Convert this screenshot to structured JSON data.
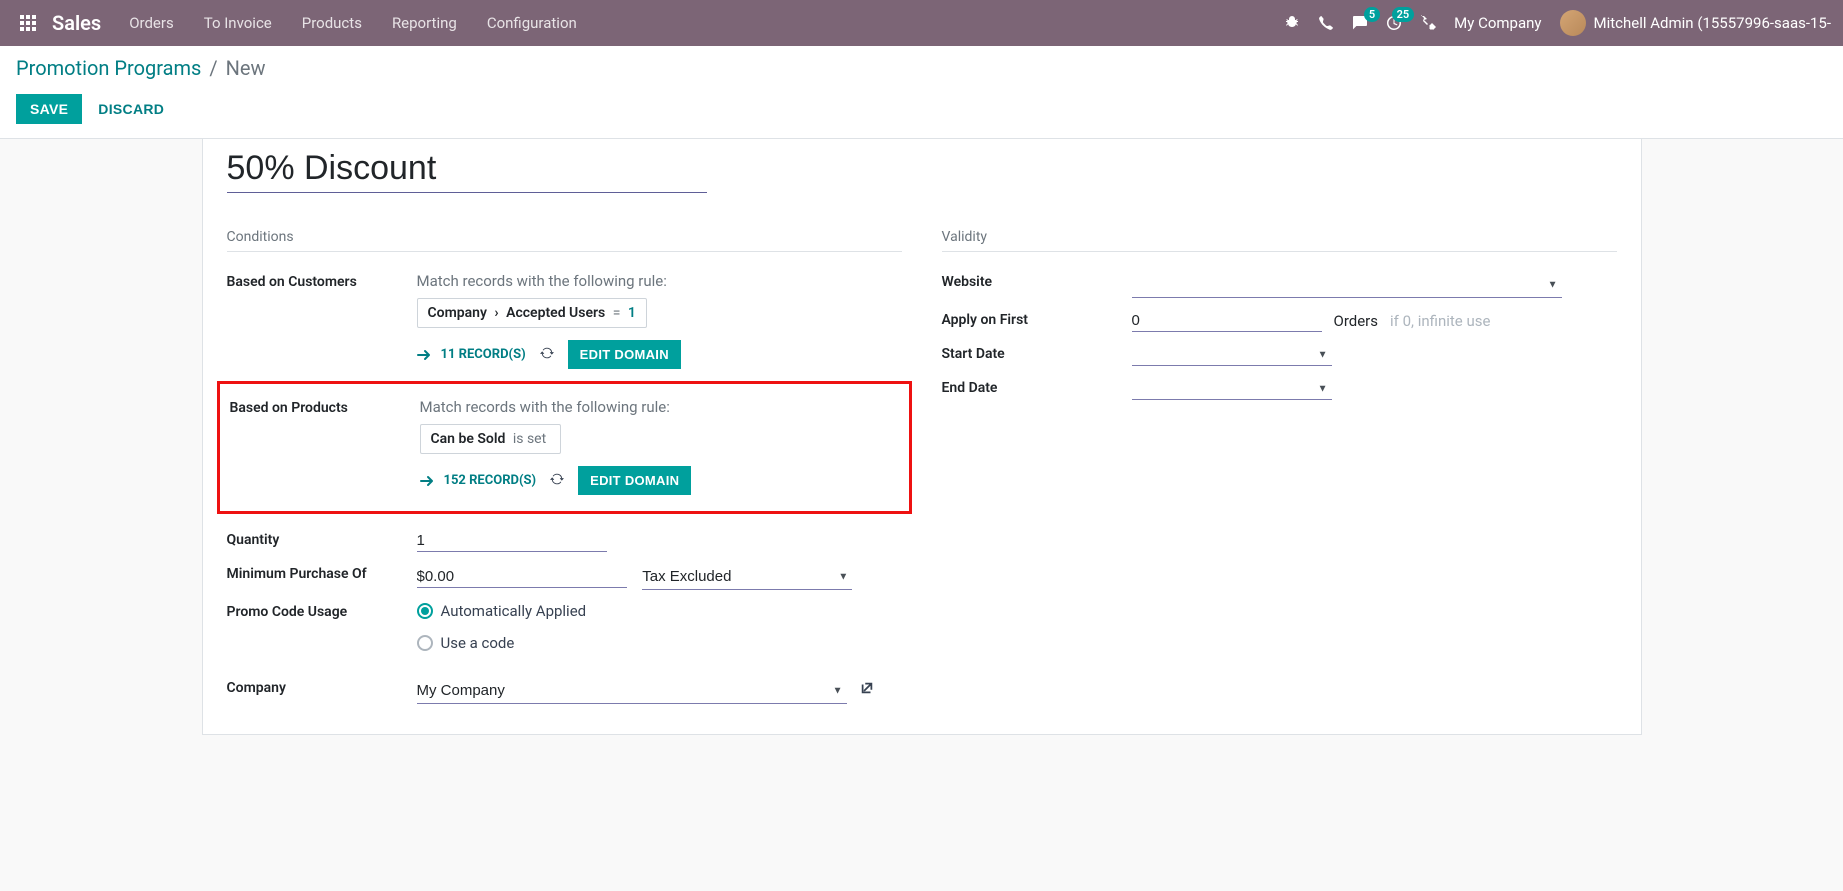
{
  "navbar": {
    "brand": "Sales",
    "menu": [
      "Orders",
      "To Invoice",
      "Products",
      "Reporting",
      "Configuration"
    ],
    "messages_badge": "5",
    "activities_badge": "25",
    "company": "My Company",
    "user": "Mitchell Admin (15557996-saas-15-"
  },
  "breadcrumb": {
    "parent": "Promotion Programs",
    "current": "New"
  },
  "buttons": {
    "save": "SAVE",
    "discard": "DISCARD",
    "edit_domain": "EDIT DOMAIN"
  },
  "form": {
    "title": "50% Discount",
    "conditions": {
      "heading": "Conditions",
      "customers_label": "Based on Customers",
      "customers_desc": "Match records with the following rule:",
      "customers_chip_field1": "Company",
      "customers_chip_field2": "Accepted Users",
      "customers_chip_op": "=",
      "customers_chip_val": "1",
      "customers_records": "11 RECORD(S)",
      "products_label": "Based on Products",
      "products_desc": "Match records with the following rule:",
      "products_chip_field": "Can be Sold",
      "products_chip_op": "is set",
      "products_records": "152 RECORD(S)",
      "quantity_label": "Quantity",
      "quantity_value": "1",
      "min_purchase_label": "Minimum Purchase Of",
      "min_purchase_value": "$0.00",
      "tax_select": "Tax Excluded",
      "promo_usage_label": "Promo Code Usage",
      "promo_auto": "Automatically Applied",
      "promo_code": "Use a code",
      "company_label": "Company",
      "company_value": "My Company"
    },
    "validity": {
      "heading": "Validity",
      "website_label": "Website",
      "apply_label": "Apply on First",
      "apply_value": "0",
      "orders_text": "Orders",
      "orders_hint": "if 0, infinite use",
      "start_label": "Start Date",
      "end_label": "End Date"
    }
  }
}
